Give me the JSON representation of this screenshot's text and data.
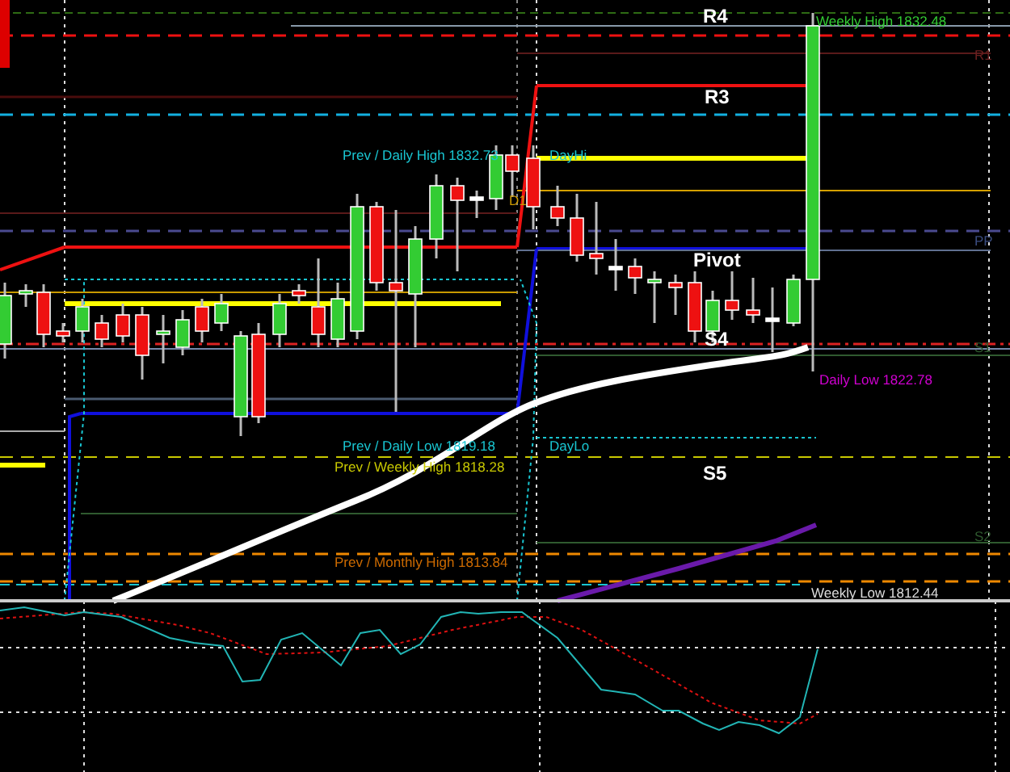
{
  "chart": {
    "labels": [
      {
        "text": "R4",
        "kind": "pivot",
        "color": "#ffffff"
      },
      {
        "text": "Weekly High 1832.48",
        "kind": "level",
        "color": "#33cc33"
      },
      {
        "text": "R1",
        "kind": "level",
        "color": "#6b2020"
      },
      {
        "text": "R3",
        "kind": "pivot",
        "color": "#ffffff"
      },
      {
        "text": "Prev / Daily High 1832.73",
        "kind": "level",
        "color": "#19c5d1"
      },
      {
        "text": "DayHi",
        "kind": "level",
        "color": "#19c5d1"
      },
      {
        "text": "D1",
        "kind": "level",
        "color": "#cc9900"
      },
      {
        "text": "PP",
        "kind": "level",
        "color": "#3a4c80"
      },
      {
        "text": "Pivot",
        "kind": "pivot",
        "color": "#ffffff"
      },
      {
        "text": "S4",
        "kind": "pivot",
        "color": "#ffffff"
      },
      {
        "text": "S1",
        "kind": "level",
        "color": "#2f5a2f"
      },
      {
        "text": "Daily Low 1822.78",
        "kind": "level",
        "color": "#d000d0"
      },
      {
        "text": "Prev / Daily Low 1819.18",
        "kind": "level",
        "color": "#19c5d1"
      },
      {
        "text": "DayLo",
        "kind": "level",
        "color": "#19c5d1"
      },
      {
        "text": "Prev / Weekly High 1818.28",
        "kind": "level",
        "color": "#c8c800"
      },
      {
        "text": "S5",
        "kind": "pivot",
        "color": "#ffffff"
      },
      {
        "text": "S2",
        "kind": "level",
        "color": "#2f5a2f"
      },
      {
        "text": "Prev / Monthly High 1813.84",
        "kind": "level",
        "color": "#cc6a00"
      },
      {
        "text": "Weekly Low 1812.44",
        "kind": "level",
        "color": "#dddddd"
      }
    ]
  }
}
